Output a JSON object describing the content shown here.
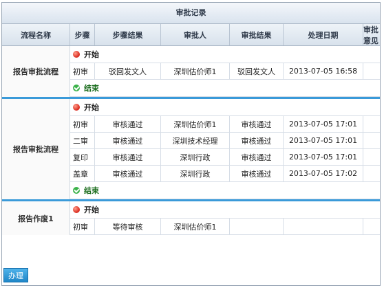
{
  "title": "审批记录",
  "columns": [
    "流程名称",
    "步骤",
    "步骤结果",
    "审批人",
    "审批结果",
    "处理日期",
    "审批意见"
  ],
  "markers": {
    "start": "开始",
    "end": "结束"
  },
  "groups": [
    {
      "name": "报告审批流程",
      "rows": [
        {
          "step": "初审",
          "step_result": "驳回发文人",
          "approver": "深圳估价师1",
          "approve_result": "驳回发文人",
          "date": "2013-07-05 16:58",
          "opinion": ""
        }
      ],
      "has_end": true
    },
    {
      "name": "报告审批流程",
      "rows": [
        {
          "step": "初审",
          "step_result": "审核通过",
          "approver": "深圳估价师1",
          "approve_result": "审核通过",
          "date": "2013-07-05 17:01",
          "opinion": ""
        },
        {
          "step": "二审",
          "step_result": "审核通过",
          "approver": "深圳技术经理",
          "approve_result": "审核通过",
          "date": "2013-07-05 17:01",
          "opinion": ""
        },
        {
          "step": "复印",
          "step_result": "审核通过",
          "approver": "深圳行政",
          "approve_result": "审核通过",
          "date": "2013-07-05 17:01",
          "opinion": ""
        },
        {
          "step": "盖章",
          "step_result": "审核通过",
          "approver": "深圳行政",
          "approve_result": "审核通过",
          "date": "2013-07-05 17:02",
          "opinion": ""
        }
      ],
      "has_end": true
    },
    {
      "name": "报告作废1",
      "rows": [
        {
          "step": "初审",
          "step_result": "等待审核",
          "approver": "深圳估价师1",
          "approve_result": "",
          "date": "",
          "opinion": ""
        }
      ],
      "has_end": false
    }
  ],
  "action_button": "办理"
}
